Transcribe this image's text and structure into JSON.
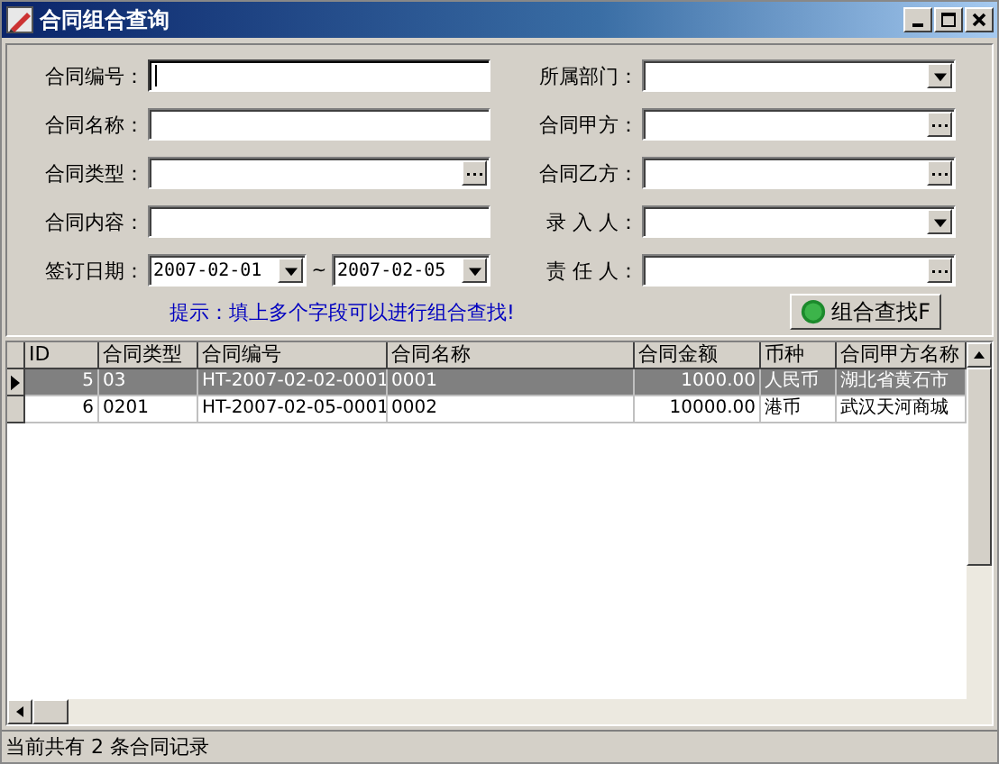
{
  "window": {
    "title": "合同组合查询"
  },
  "left_fields": [
    {
      "label": "合同编号：",
      "kind": "text",
      "focused": true
    },
    {
      "label": "合同名称：",
      "kind": "text",
      "focused": false
    },
    {
      "label": "合同类型：",
      "kind": "lookup",
      "focused": false
    },
    {
      "label": "合同内容：",
      "kind": "text",
      "focused": false
    }
  ],
  "date_range": {
    "label": "签订日期：",
    "from": "2007-02-01",
    "separator": "~",
    "to": "2007-02-05"
  },
  "right_fields": [
    {
      "label": "所属部门：",
      "kind": "dropdown",
      "focused": false
    },
    {
      "label": "合同甲方：",
      "kind": "lookup",
      "focused": false
    },
    {
      "label": "合同乙方：",
      "kind": "lookup",
      "focused": false
    },
    {
      "label": "录 入 人：",
      "kind": "dropdown",
      "focused": false
    },
    {
      "label": "责 任 人：",
      "kind": "lookup",
      "focused": false
    }
  ],
  "hint": "提示：填上多个字段可以进行组合查找!",
  "search_button": {
    "label": "组合查找F"
  },
  "table": {
    "columns": [
      {
        "label": "ID"
      },
      {
        "label": "合同类型"
      },
      {
        "label": "合同编号"
      },
      {
        "label": "合同名称"
      },
      {
        "label": "合同金额"
      },
      {
        "label": "币种"
      },
      {
        "label": "合同甲方名称"
      }
    ],
    "rows": [
      {
        "selected": true,
        "cells": [
          "5",
          "03",
          "HT-2007-02-02-0001",
          "0001",
          "1000.00",
          "人民币",
          "湖北省黄石市"
        ]
      },
      {
        "selected": false,
        "cells": [
          "6",
          "0201",
          "HT-2007-02-05-0001",
          "0002",
          "10000.00",
          "港币",
          "武汉天河商城"
        ]
      }
    ]
  },
  "status_bar": "当前共有 2 条合同记录"
}
